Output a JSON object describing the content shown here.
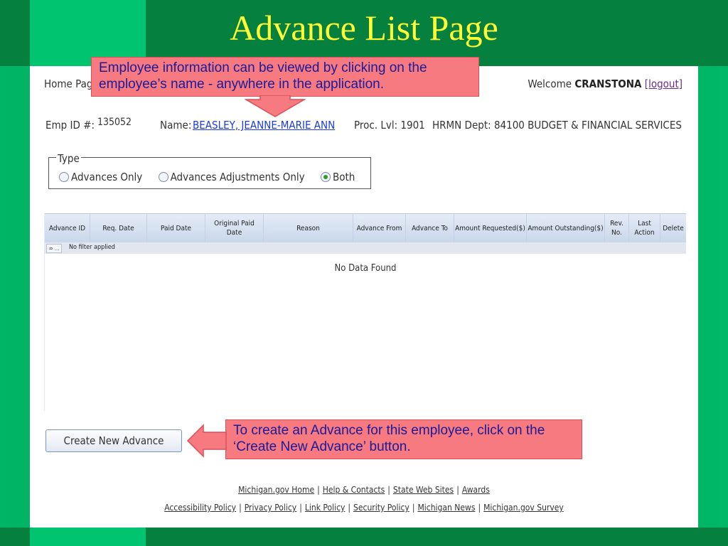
{
  "slide": {
    "title": "Advance List Page"
  },
  "header": {
    "home_link": "Home Pag",
    "welcome_text": "Welcome",
    "username": "CRANSTONA",
    "logout_label": "[logout]"
  },
  "employee": {
    "emp_id_label": "Emp ID #:",
    "emp_id": "135052",
    "name_label": "Name:",
    "name": "BEASLEY, JEANNE-MARIE ANN",
    "proc_lvl": "Proc. Lvl: 1901",
    "dept": "HRMN Dept: 84100 BUDGET & FINANCIAL SERVICES"
  },
  "type_filter": {
    "legend": "Type",
    "options": [
      {
        "label": "Advances Only",
        "checked": false
      },
      {
        "label": "Advances Adjustments Only",
        "checked": false
      },
      {
        "label": "Both",
        "checked": true
      }
    ]
  },
  "grid": {
    "columns": [
      "Advance ID",
      "Req. Date",
      "Paid Date",
      "Original Paid Date",
      "Reason",
      "Advance From",
      "Advance To",
      "Amount Requested($)",
      "Amount Outstanding($)",
      "Rev. No.",
      "Last Action",
      "Delete"
    ],
    "filter_icon": "⇏ ...",
    "filter_text": "No filter applied",
    "empty_text": "No Data Found"
  },
  "create_button": {
    "label": "Create New Advance"
  },
  "footer": {
    "row1": [
      "Michigan.gov Home",
      "Help & Contacts",
      "State Web Sites",
      "Awards"
    ],
    "row2": [
      "Accessibility Policy",
      "Privacy Policy",
      "Link Policy",
      "Security Policy",
      "Michigan News",
      "Michigan.gov Survey"
    ]
  },
  "callouts": {
    "employee_info": "Employee information can be viewed by clicking on the employee’s name - anywhere in the application.",
    "create_advance": "To create an Advance for this employee, click on the ‘Create New Advance’ button."
  },
  "colors": {
    "title": "#ffff33",
    "callout_bg": "#f67a80",
    "callout_text": "#1a1a9a",
    "link": "#1a3bd6",
    "background_green": "#00a85e"
  }
}
